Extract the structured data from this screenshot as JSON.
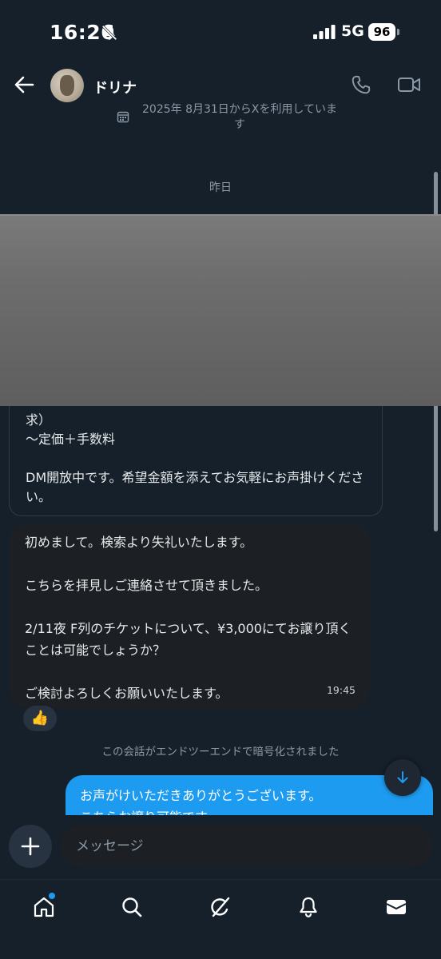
{
  "status_bar": {
    "time": "16:26",
    "network": "5G",
    "battery": "96"
  },
  "header": {
    "contact_name": "ドリナ"
  },
  "info": {
    "joined_text": "2025年 8月31日からXを利用しています"
  },
  "date_separator": "昨日",
  "messages": {
    "incoming_partial": {
      "lines": [
        "求）",
        "〜定価＋手数料",
        "",
        "DM開放中です。希望金額を添えてお気軽にお声掛けください。"
      ]
    },
    "incoming_main": {
      "lines": [
        "初めまして。検索より失礼いたします。",
        "",
        "こちらを拝見しご連絡させて頂きました。",
        "",
        "2/11夜 F列のチケットについて、¥3,000にてお譲り頂くことは可能でしょうか？",
        "",
        "ご検討よろしくお願いいたします。"
      ],
      "time": "19:45",
      "reaction": "👍"
    },
    "encryption_note": "この会話がエンドツーエンドで暗号化されました",
    "outgoing": {
      "lines": [
        "お声がけいただきありがとうございます。",
        "こちらお譲り可能です。"
      ]
    }
  },
  "composer": {
    "placeholder": "メッセージ"
  },
  "colors": {
    "background": "#15202b",
    "accent": "#1d9bf0",
    "incoming_bubble": "#1c1f23",
    "muted_text": "#8b98a5"
  },
  "icons": {
    "nav": [
      "home-icon",
      "search-icon",
      "grok-icon",
      "notifications-icon",
      "messages-icon"
    ]
  }
}
